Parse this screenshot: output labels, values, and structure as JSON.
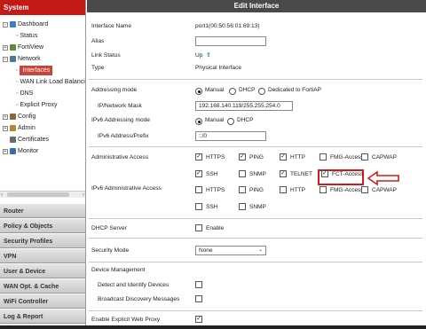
{
  "sidebar": {
    "header": "System",
    "tree": [
      {
        "label": "Dashboard",
        "type": "expand",
        "sym": "−",
        "color": "#3a7bd5"
      },
      {
        "label": "Status",
        "type": "leaf"
      },
      {
        "label": "FortiView",
        "type": "expand",
        "sym": "+",
        "color": "#5a8a3a"
      },
      {
        "label": "Network",
        "type": "expand",
        "sym": "−",
        "color": "#4a7a9a"
      },
      {
        "label": "Interfaces",
        "type": "leaf",
        "selected": true
      },
      {
        "label": "WAN Link Load Balancing",
        "type": "leaf"
      },
      {
        "label": "DNS",
        "type": "leaf"
      },
      {
        "label": "Explicit Proxy",
        "type": "leaf"
      },
      {
        "label": "Config",
        "type": "expand",
        "sym": "+",
        "color": "#8a6a3a"
      },
      {
        "label": "Admin",
        "type": "expand",
        "sym": "+",
        "color": "#b08a2a"
      },
      {
        "label": "Certificates",
        "type": "plain",
        "color": "#6a6a6a"
      },
      {
        "label": "Monitor",
        "type": "expand",
        "sym": "+",
        "color": "#3a6ab0"
      }
    ],
    "sections": [
      "Router",
      "Policy & Objects",
      "Security Profiles",
      "VPN",
      "User & Device",
      "WAN Opt. & Cache",
      "WiFi Controller",
      "Log & Report"
    ]
  },
  "main": {
    "title": "Edit Interface",
    "interface_name_label": "Interface Name",
    "interface_name_value": "port1(00:50:56:01:69:13)",
    "alias_label": "Alias",
    "alias_value": "",
    "link_status_label": "Link Status",
    "link_status_value": "Up",
    "link_status_icon": "up-arrow-icon",
    "type_label": "Type",
    "type_value": "Physical Interface",
    "addressing_mode_label": "Addressing mode",
    "addressing_options": [
      "Manual",
      "DHCP",
      "Dedicated to FortiAP"
    ],
    "ip_mask_label": "IP/Network Mask",
    "ip_mask_value": "192.168.140.119/255.255.254.0",
    "ipv6_addressing_label": "IPv6 Addressing mode",
    "ipv6_addressing_options": [
      "Manual",
      "DHCP"
    ],
    "ipv6_address_label": "IPv6 Address/Prefix",
    "ipv6_address_value": "::/0",
    "admin_access_label": "Administrative Access",
    "admin_access_row1": [
      "HTTPS",
      "PING",
      "HTTP",
      "FMG-Access",
      "CAPWAP"
    ],
    "admin_access_row2": [
      "SSH",
      "SNMP",
      "TELNET",
      "FCT-Access"
    ],
    "ipv6_admin_access_label": "IPv6 Administrative Access",
    "ipv6_admin_row1": [
      "HTTPS",
      "PING",
      "HTTP",
      "FMG-Access",
      "CAPWAP"
    ],
    "ipv6_admin_row2": [
      "SSH",
      "SNMP"
    ],
    "dhcp_server_label": "DHCP Server",
    "dhcp_server_option": "Enable",
    "security_mode_label": "Security Mode",
    "security_mode_value": "None",
    "device_mgmt_label": "Device Management",
    "detect_devices_label": "Detect and Identify Devices",
    "broadcast_label": "Broadcast Discovery Messages",
    "explicit_proxy_label": "Enable Explicit Web Proxy"
  },
  "colors": {
    "brand": "#c41a16",
    "highlight": "#d41a1a",
    "title_bar": "#4a4a4a",
    "status_up": "#2a9a2a"
  }
}
